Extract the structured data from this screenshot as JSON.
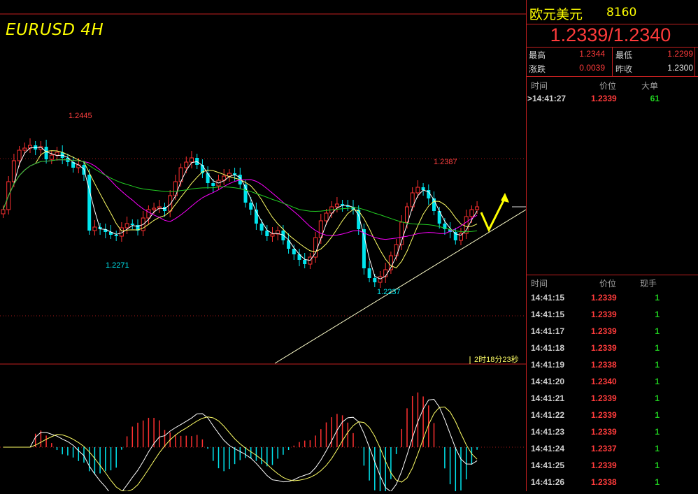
{
  "chart": {
    "symbol_title": "EURUSD 4H",
    "high_label": "1.2445",
    "low_label_left": "1.2271",
    "low_label_mid": "1.2237",
    "high_label_right": "1.2387",
    "countdown": "2时18分23秒",
    "colors": {
      "up": "#ff3030",
      "down": "#00e5ee",
      "ma_white": "#ffffff",
      "ma_yellow": "#ffff66",
      "ma_magenta": "#ff00ff",
      "ma_green": "#22cc22",
      "trendline": "#ffffcc",
      "arrow": "#ffff00",
      "grid": "#a01818"
    }
  },
  "quote": {
    "name": "欧元美元",
    "code": "8160",
    "bid_ask": "1.2339/1.2340",
    "high_label": "最高",
    "high_value": "1.2344",
    "low_label": "最低",
    "low_value": "1.2299",
    "change_label": "涨跌",
    "change_value": "0.0039",
    "prev_label": "昨收",
    "prev_value": "1.2300"
  },
  "big_orders": {
    "headers": [
      "时间",
      "价位",
      "大单"
    ],
    "rows": [
      {
        "time": ">14:41:27",
        "price": "1.2339",
        "volume": "61"
      }
    ]
  },
  "ticks": {
    "headers": [
      "时间",
      "价位",
      "现手"
    ],
    "rows": [
      {
        "time": "14:41:15",
        "price": "1.2339",
        "volume": "1"
      },
      {
        "time": "14:41:15",
        "price": "1.2339",
        "volume": "1"
      },
      {
        "time": "14:41:17",
        "price": "1.2339",
        "volume": "1"
      },
      {
        "time": "14:41:18",
        "price": "1.2339",
        "volume": "1"
      },
      {
        "time": "14:41:19",
        "price": "1.2338",
        "volume": "1"
      },
      {
        "time": "14:41:20",
        "price": "1.2340",
        "volume": "1"
      },
      {
        "time": "14:41:21",
        "price": "1.2339",
        "volume": "1"
      },
      {
        "time": "14:41:22",
        "price": "1.2339",
        "volume": "1"
      },
      {
        "time": "14:41:23",
        "price": "1.2339",
        "volume": "1"
      },
      {
        "time": "14:41:24",
        "price": "1.2337",
        "volume": "1"
      },
      {
        "time": "14:41:25",
        "price": "1.2339",
        "volume": "1"
      },
      {
        "time": "14:41:26",
        "price": "1.2338",
        "volume": "1"
      }
    ]
  }
}
